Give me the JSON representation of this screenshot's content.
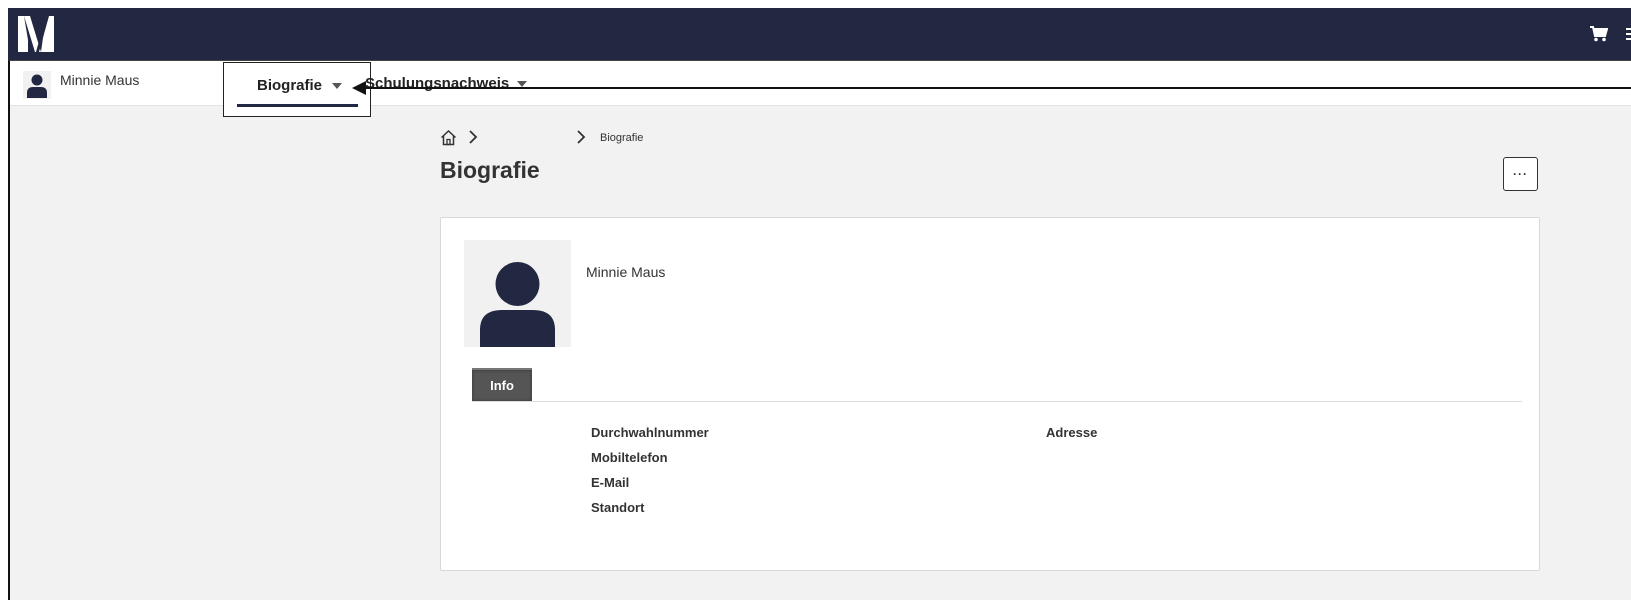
{
  "header": {
    "logo_icon": "brand-logo-icon",
    "cart_icon": "cart-icon",
    "menu_icon": "menu-icon",
    "bar_color": "#222841"
  },
  "nav": {
    "user_name": "Minnie Maus",
    "avatar_icon": "user-avatar-icon",
    "tabs": [
      {
        "label": "Biografie",
        "icon": "caret-down-icon",
        "active": true
      },
      {
        "label": "Schulungsnachweis",
        "icon": "caret-down-icon",
        "active": false
      }
    ]
  },
  "breadcrumb": {
    "home_icon": "home-icon",
    "separator_icon": "chevron-right-icon",
    "current": "Biografie"
  },
  "page": {
    "title": "Biografie",
    "more_label": "···"
  },
  "profile": {
    "name": "Minnie Maus",
    "photo_icon": "user-avatar-icon",
    "tabs": [
      {
        "label": "Info",
        "active": true
      }
    ],
    "fields_left": [
      "Durchwahlnummer",
      "Mobiltelefon",
      "E-Mail",
      "Standort"
    ],
    "fields_right": [
      "Adresse"
    ]
  }
}
